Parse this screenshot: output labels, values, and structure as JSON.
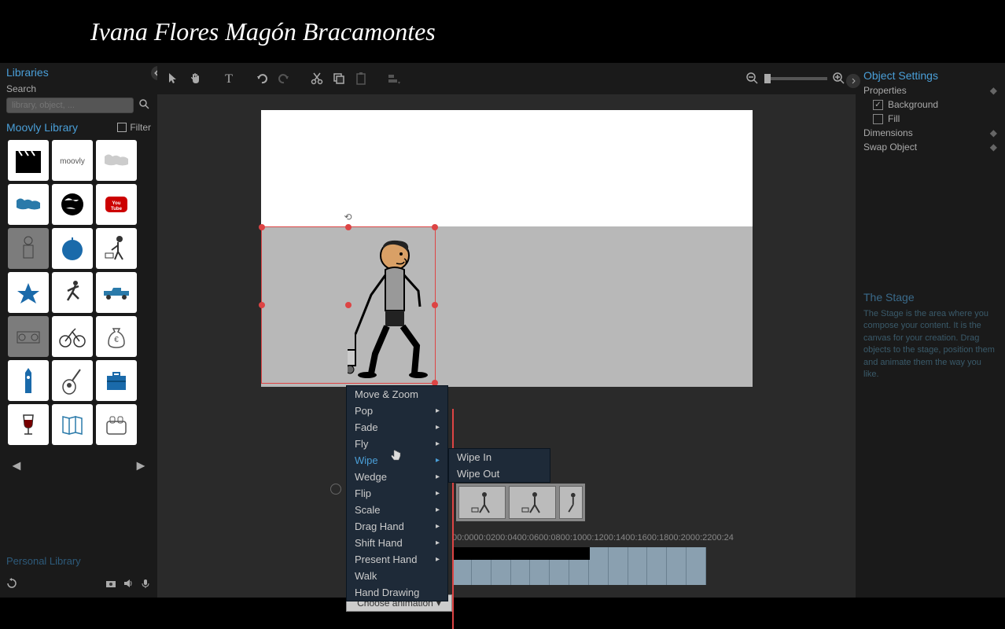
{
  "header": {
    "title": "Ivana Flores Magón Bracamontes"
  },
  "sidebar_left": {
    "title": "Libraries",
    "search_label": "Search",
    "search_placeholder": "library, object, ...",
    "library_title": "Moovly Library",
    "filter_label": "Filter",
    "thumbs": [
      {
        "name": "clapper",
        "enabled": true
      },
      {
        "name": "moovly-logo",
        "enabled": true
      },
      {
        "name": "world-map",
        "enabled": true
      },
      {
        "name": "world-map-dark",
        "enabled": true
      },
      {
        "name": "globe",
        "enabled": true
      },
      {
        "name": "youtube",
        "enabled": true
      },
      {
        "name": "businessman",
        "enabled": false
      },
      {
        "name": "apple",
        "enabled": true
      },
      {
        "name": "person-cart",
        "enabled": true
      },
      {
        "name": "star-figure",
        "enabled": true
      },
      {
        "name": "runner",
        "enabled": true
      },
      {
        "name": "pickup-truck",
        "enabled": true
      },
      {
        "name": "stereo",
        "enabled": false
      },
      {
        "name": "bicycle",
        "enabled": true
      },
      {
        "name": "money-bag",
        "enabled": true
      },
      {
        "name": "big-ben",
        "enabled": true
      },
      {
        "name": "guitar",
        "enabled": true
      },
      {
        "name": "briefcase",
        "enabled": true
      },
      {
        "name": "wine-glass",
        "enabled": true
      },
      {
        "name": "brochure",
        "enabled": true
      },
      {
        "name": "toaster",
        "enabled": true
      }
    ],
    "personal_library": "Personal Library"
  },
  "context_menu": {
    "items": [
      {
        "label": "Move & Zoom",
        "arrow": false
      },
      {
        "label": "Pop",
        "arrow": true
      },
      {
        "label": "Fade",
        "arrow": true
      },
      {
        "label": "Fly",
        "arrow": true
      },
      {
        "label": "Wipe",
        "arrow": true,
        "hover": true
      },
      {
        "label": "Wedge",
        "arrow": true
      },
      {
        "label": "Flip",
        "arrow": true
      },
      {
        "label": "Scale",
        "arrow": true
      },
      {
        "label": "Drag Hand",
        "arrow": true
      },
      {
        "label": "Shift Hand",
        "arrow": true
      },
      {
        "label": "Present Hand",
        "arrow": true
      },
      {
        "label": "Walk",
        "arrow": false
      },
      {
        "label": "Hand Drawing",
        "arrow": false
      }
    ],
    "submenu": [
      {
        "label": "Wipe In"
      },
      {
        "label": "Wipe Out"
      }
    ],
    "choose_animation": "Choose animation"
  },
  "timeline": {
    "ticks": [
      "00:00",
      "00:02",
      "00:04",
      "00:06",
      "00:08",
      "00:10",
      "00:12",
      "00:14",
      "00:16",
      "00:18",
      "00:20",
      "00:22",
      "00:24"
    ]
  },
  "sidebar_right": {
    "title": "Object Settings",
    "properties": "Properties",
    "background": "Background",
    "fill": "Fill",
    "dimensions": "Dimensions",
    "swap_object": "Swap Object",
    "help_title": "The Stage",
    "help_text": "The Stage is the area where you compose your content. It is the canvas for your creation. Drag objects to the stage, position them and animate them the way you like."
  }
}
